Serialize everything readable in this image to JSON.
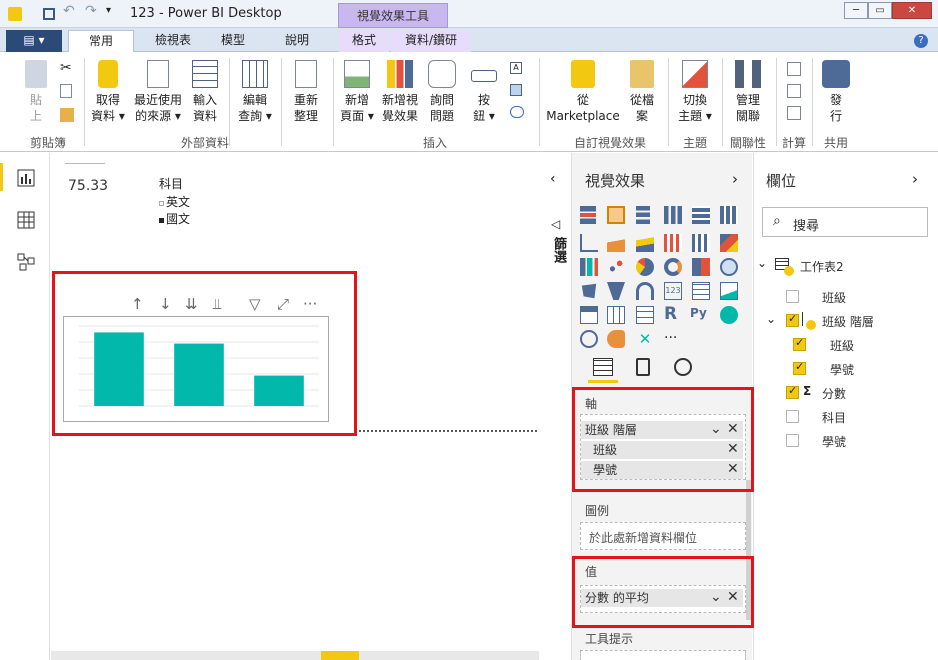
{
  "window": {
    "title": "123 - Power BI Desktop",
    "context_tab_header": "視覺效果工具",
    "controls": [
      "─",
      "▭",
      "✕"
    ]
  },
  "tabs": {
    "file": "▤ ▾",
    "items": [
      {
        "label": "常用"
      },
      {
        "label": "檢視表"
      },
      {
        "label": "模型"
      },
      {
        "label": "說明"
      },
      {
        "label": "格式"
      },
      {
        "label": "資料/鑽研"
      }
    ]
  },
  "ribbon": {
    "paste": "貼\n上",
    "get_data": "取得\n資料 ▾",
    "recent_sources": "最近使用\n的來源 ▾",
    "enter_data": "輸入\n資料",
    "edit_queries": "編輯\n查詢 ▾",
    "refresh": "重新\n整理",
    "new_page": "新增\n頁面 ▾",
    "new_visual": "新增視\n覺效果",
    "ask_question": "詢問\n問題",
    "buttons": "按\n鈕 ▾",
    "from_marketplace": "從\nMarketplace",
    "from_file": "從檔\n案",
    "switch_theme": "切換\n主題 ▾",
    "manage_relationships": "管理\n關聯",
    "publish": "發\n行",
    "groups": {
      "clipboard": "剪貼簿",
      "external_data": "外部資料",
      "insert": "插入",
      "custom_visuals": "自訂視覺效果",
      "themes": "主題",
      "relationships": "關聯性",
      "calculations": "計算",
      "share": "共用"
    }
  },
  "canvas": {
    "card_value": "75.33",
    "legend_title": "科目",
    "legend_items": [
      "英文",
      "國文"
    ],
    "chart_toolbar": [
      "↑",
      "↓",
      "⇊",
      "⫫",
      "▽",
      "⤢",
      "···"
    ]
  },
  "chart_data": {
    "type": "bar",
    "categories": [
      "",
      "",
      ""
    ],
    "values": [
      92,
      78,
      38
    ],
    "ylim": [
      0,
      100
    ],
    "color": "#01b8aa"
  },
  "visualizations": {
    "title": "視覺效果",
    "side_label": "篩選",
    "more": "···",
    "wells": {
      "axis": {
        "label": "軸",
        "hierarchy": "班級 階層",
        "items": [
          "班級",
          "學號"
        ]
      },
      "legend": {
        "label": "圖例",
        "placeholder": "於此處新增資料欄位"
      },
      "values": {
        "label": "值",
        "item": "分數 的平均"
      },
      "tooltip": {
        "label": "工具提示"
      }
    }
  },
  "fields": {
    "title": "欄位",
    "search_placeholder": "搜尋",
    "table_name": "工作表2",
    "items": [
      {
        "label": "班級",
        "checked": false
      },
      {
        "label": "班級 階層",
        "checked": true
      },
      {
        "label": "班級",
        "checked": true
      },
      {
        "label": "學號",
        "checked": true
      },
      {
        "label": "分數",
        "checked": true
      },
      {
        "label": "科目",
        "checked": false
      },
      {
        "label": "學號",
        "checked": false
      }
    ]
  },
  "colors": {
    "accent": "#f2c811",
    "annotation_red": "#e3141b",
    "bar_teal": "#01b8aa"
  }
}
